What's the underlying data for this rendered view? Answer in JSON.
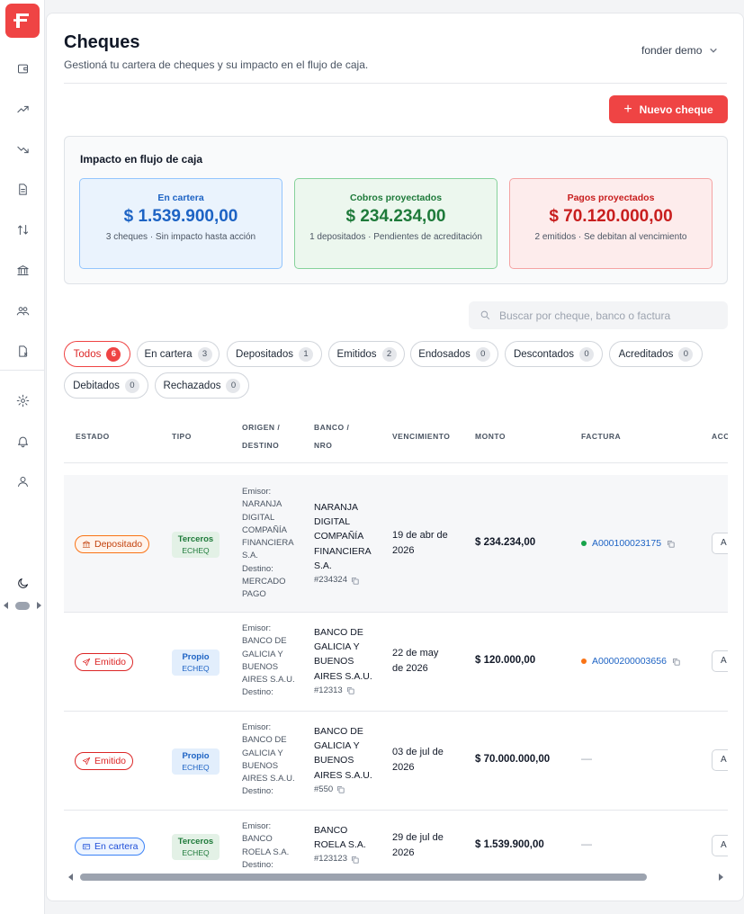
{
  "app": {
    "logo_text": "F",
    "accent": "#ef4444"
  },
  "sidebar": {
    "items": [
      {
        "name": "wallet-icon"
      },
      {
        "name": "trending-up-icon"
      },
      {
        "name": "trending-down-icon"
      },
      {
        "name": "document-icon"
      },
      {
        "name": "cashflow-icon"
      },
      {
        "name": "bank-icon"
      },
      {
        "name": "users-icon"
      },
      {
        "name": "receipt-icon"
      },
      {
        "name": "gear-icon"
      },
      {
        "name": "bell-icon"
      },
      {
        "name": "user-icon"
      },
      {
        "name": "moon-icon"
      }
    ]
  },
  "header": {
    "title": "Cheques",
    "subtitle": "Gestioná tu cartera de cheques y su impacto en el flujo de caja.",
    "user": "fonder demo"
  },
  "actions": {
    "new_cheque": "Nuevo cheque"
  },
  "impact": {
    "title": "Impacto en flujo de caja",
    "cards": [
      {
        "label": "En cartera",
        "amount": "$ 1.539.900,00",
        "note": "3 cheques · Sin impacto hasta acción",
        "color": "#1d63c4"
      },
      {
        "label": "Cobros proyectados",
        "amount": "$ 234.234,00",
        "note": "1 depositados · Pendientes de acreditación",
        "color": "#1e7a3a"
      },
      {
        "label": "Pagos proyectados",
        "amount": "$ 70.120.000,00",
        "note": "2 emitidos · Se debitan al vencimiento",
        "color": "#c81e1e"
      }
    ]
  },
  "search": {
    "placeholder": "Buscar por cheque, banco o factura",
    "value": ""
  },
  "filters": [
    {
      "label": "Todos",
      "count": "6",
      "active": true
    },
    {
      "label": "En cartera",
      "count": "3"
    },
    {
      "label": "Depositados",
      "count": "1"
    },
    {
      "label": "Emitidos",
      "count": "2"
    },
    {
      "label": "Endosados",
      "count": "0"
    },
    {
      "label": "Descontados",
      "count": "0"
    },
    {
      "label": "Acreditados",
      "count": "0"
    },
    {
      "label": "Debitados",
      "count": "0"
    },
    {
      "label": "Rechazados",
      "count": "0"
    }
  ],
  "table": {
    "headers": {
      "estado": "ESTADO",
      "tipo": "TIPO",
      "origen_1": "ORIGEN /",
      "origen_2": "DESTINO",
      "banco_1": "BANCO /",
      "banco_2": "NRO",
      "vencimiento": "VENCIMIENTO",
      "monto": "MONTO",
      "factura": "FACTURA",
      "acciones": "ACC"
    },
    "rows": [
      {
        "estado": "Depositado",
        "estado_icon": "bank-icon",
        "tipo": "Terceros",
        "tipo_sub": "ECHEQ",
        "emisor_label": "Emisor:",
        "emisor_lines": [
          "NARANJA",
          "DIGITAL",
          "COMPAÑÍA",
          "FINANCIERA",
          "S.A."
        ],
        "destino_label": "Destino:",
        "destino_lines": [
          "MERCADO",
          "PAGO"
        ],
        "banco_lines": [
          "NARANJA",
          "DIGITAL",
          "COMPAÑÍA",
          "FINANCIERA",
          "S.A."
        ],
        "nro": "#234324",
        "venc_lines": [
          "19 de abr de",
          "2026"
        ],
        "monto": "$ 234.234,00",
        "factura": "A000100023175",
        "factura_dot": "#16a34a",
        "accion": "A"
      },
      {
        "estado": "Emitido",
        "estado_icon": "send-icon",
        "tipo": "Propio",
        "tipo_sub": "ECHEQ",
        "emisor_label": "Emisor:",
        "emisor_lines": [
          "BANCO DE",
          "GALICIA Y",
          "BUENOS",
          "AIRES S.A.U."
        ],
        "destino_label": "Destino:",
        "destino_lines": [],
        "banco_lines": [
          "BANCO DE",
          "GALICIA Y",
          "BUENOS",
          "AIRES S.A.U."
        ],
        "nro": "#12313",
        "venc_lines": [
          "22 de may",
          "de 2026"
        ],
        "monto": "$ 120.000,00",
        "factura": "A0000200003656",
        "factura_dot": "#f97316",
        "accion": "A"
      },
      {
        "estado": "Emitido",
        "estado_icon": "send-icon",
        "tipo": "Propio",
        "tipo_sub": "ECHEQ",
        "emisor_label": "Emisor:",
        "emisor_lines": [
          "BANCO DE",
          "GALICIA Y",
          "BUENOS",
          "AIRES S.A.U."
        ],
        "destino_label": "Destino:",
        "destino_lines": [],
        "banco_lines": [
          "BANCO DE",
          "GALICIA Y",
          "BUENOS",
          "AIRES S.A.U."
        ],
        "nro": "#550",
        "venc_lines": [
          "03 de jul de",
          "2026"
        ],
        "monto": "$ 70.000.000,00",
        "factura": "—",
        "accion": "A"
      },
      {
        "estado": "En cartera",
        "estado_icon": "wallet-icon",
        "tipo": "Terceros",
        "tipo_sub": "ECHEQ",
        "emisor_label": "Emisor:",
        "emisor_lines": [
          "BANCO",
          "ROELA S.A."
        ],
        "destino_label": "Destino:",
        "destino_lines": [],
        "banco_lines": [
          "BANCO",
          "ROELA S.A."
        ],
        "nro": "#123123",
        "venc_lines": [
          "29 de jul de",
          "2026"
        ],
        "monto": "$ 1.539.900,00",
        "factura": "—",
        "accion": "A"
      }
    ]
  }
}
